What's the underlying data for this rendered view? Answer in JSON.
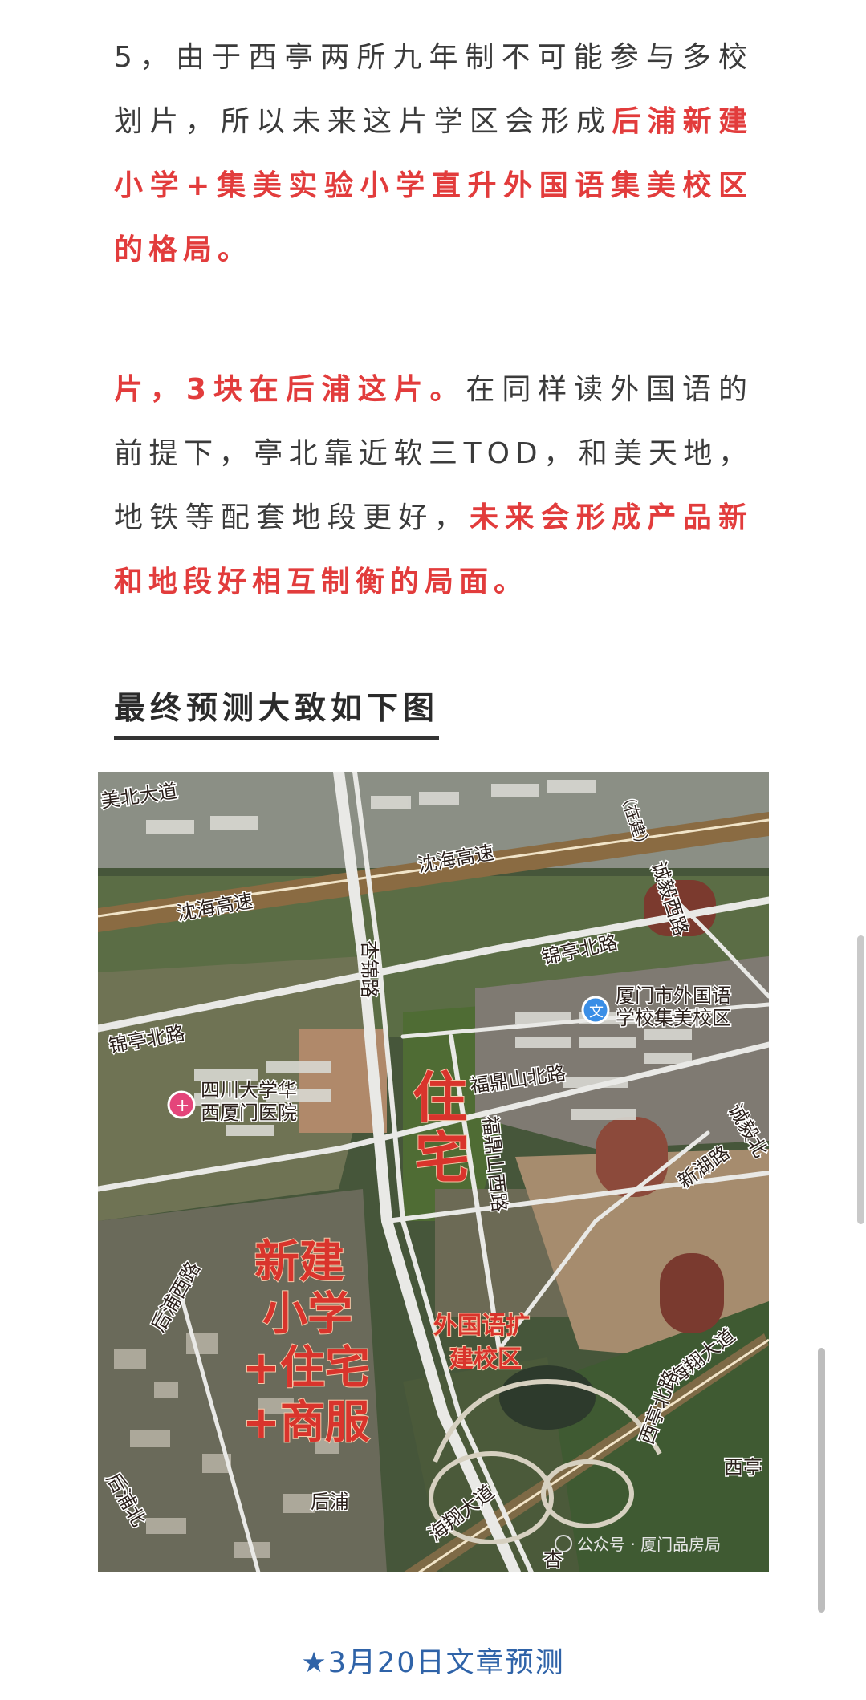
{
  "article": {
    "para1": {
      "normal": "5，由于西亭两所九年制不可能参与多校划片，所以未来这片学区会形成",
      "highlight": "后浦新建小学+集美实验小学直升外国语集美校区的格局。"
    },
    "para2": {
      "highlight1": "片，3块在后浦这片。",
      "normal": "在同样读外国语的前提下，亭北靠近软三TOD，和美天地，地铁等配套地段更好，",
      "highlight2": "未来会形成产品新和地段好相互制衡的局面。"
    },
    "heading": "最终预测大致如下图",
    "caption": "★3月20日文章预测"
  },
  "map": {
    "roads": {
      "meibei": "美北大道",
      "shenhai_right": "沈海高速",
      "shenhai_left": "沈海高速",
      "chengyi_west": "诚毅西路",
      "chengyi_construction": "（在建）",
      "xingjin": "杏锦路",
      "jinting_right": "锦亭北路",
      "jinting_left": "锦亭北路",
      "fudingshan_north": "福鼎山北路",
      "fudingshan_west": "福鼎山西路",
      "xinhu": "新湖路",
      "chengyi_north": "诚毅北",
      "houpu_west": "后浦西路",
      "houpu_north": "后浦北",
      "haixiang_right": "海翔大道",
      "haixiang_bottom": "海翔大道",
      "xiting_north": "西亭北路",
      "xiting": "西亭",
      "bottom_partial": "杏"
    },
    "pois": {
      "school": {
        "line1": "厦门市外国语",
        "line2": "学校集美校区"
      },
      "hospital": {
        "line1": "四川大学华",
        "line2": "西厦门医院"
      },
      "houpu": "后浦"
    },
    "annotations": {
      "zhuzhai": {
        "line1": "住",
        "line2": "宅"
      },
      "new_school": {
        "line1": "新建",
        "line2": "小学",
        "line3": "+住宅",
        "line4": "+商服"
      },
      "expansion": {
        "line1": "外国语扩",
        "line2": "建校区"
      }
    },
    "watermark": "公众号 · 厦门品房局",
    "colors": {
      "annotation": "#d9342c",
      "school_pin": "#3a8ee6",
      "hospital_pin": "#e4457a"
    }
  }
}
